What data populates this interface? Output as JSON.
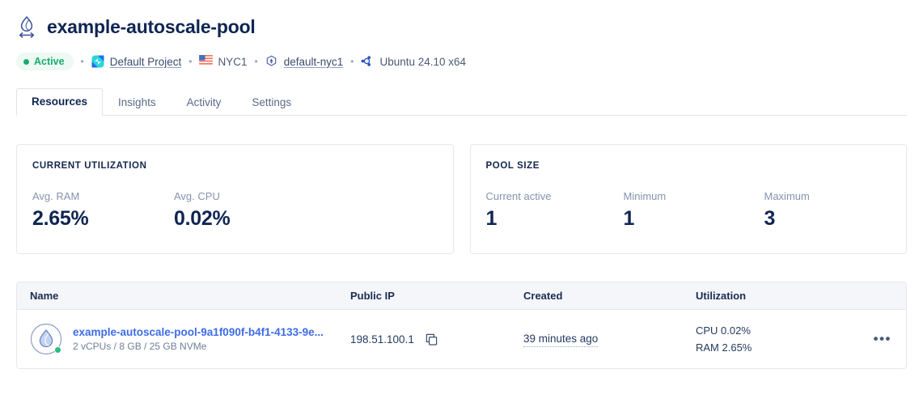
{
  "header": {
    "icon": "autoscale-pool-droplet-icon",
    "title": "example-autoscale-pool",
    "status": {
      "label": "Active",
      "color": "#19a974",
      "background": "#edf9f2"
    },
    "meta": {
      "project_label": "Default Project",
      "project_icon": "project-icon",
      "region_label": "NYC1",
      "region_icon": "us-flag-icon",
      "vpc_label": "default-nyc1",
      "vpc_icon": "vpc-hexagon-icon",
      "os_label": "Ubuntu 24.10 x64",
      "os_icon": "ubuntu-icon",
      "separator": "•"
    }
  },
  "tabs": [
    {
      "label": "Resources",
      "active": true
    },
    {
      "label": "Insights",
      "active": false
    },
    {
      "label": "Activity",
      "active": false
    },
    {
      "label": "Settings",
      "active": false
    }
  ],
  "cards": {
    "utilization": {
      "title": "CURRENT UTILIZATION",
      "stats": [
        {
          "label": "Avg. RAM",
          "value": "2.65%"
        },
        {
          "label": "Avg. CPU",
          "value": "0.02%"
        }
      ]
    },
    "pool_size": {
      "title": "POOL SIZE",
      "stats": [
        {
          "label": "Current active",
          "value": "1"
        },
        {
          "label": "Minimum",
          "value": "1"
        },
        {
          "label": "Maximum",
          "value": "3"
        }
      ]
    }
  },
  "table": {
    "columns": [
      "Name",
      "Public IP",
      "Created",
      "Utilization"
    ],
    "rows": [
      {
        "name": "example-autoscale-pool-9a1f090f-b4f1-4133-9e...",
        "specs": "2 vCPUs / 8 GB / 25 GB NVMe",
        "public_ip": "198.51.100.1",
        "copy_icon": "copy-icon",
        "created": "39 minutes ago",
        "utilization_cpu": "CPU 0.02%",
        "utilization_ram": "RAM 2.65%",
        "status_indicator": "online",
        "menu_icon": "•••"
      }
    ]
  },
  "colors": {
    "accent_link": "#3d6ce7",
    "title": "#0f2552",
    "muted": "#8494ad",
    "border": "#e5e8ef",
    "table_header_bg": "#f4f6fa",
    "online_green": "#27c07c"
  }
}
